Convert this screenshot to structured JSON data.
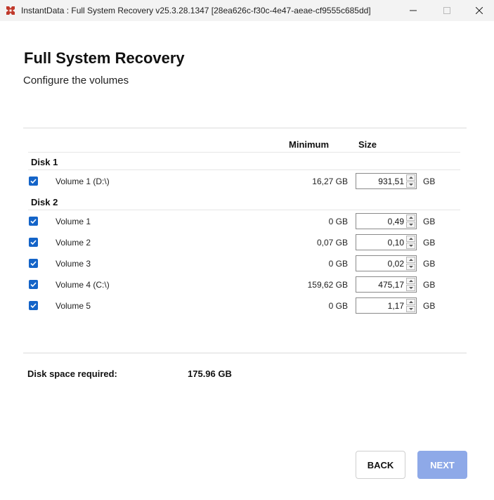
{
  "window": {
    "title": "InstantData : Full System Recovery v25.3.28.1347 [28ea626c-f30c-4e47-aeae-cf9555c685dd]",
    "icon": "app-logo-icon",
    "accent": "#c0392b"
  },
  "header": {
    "title": "Full System Recovery",
    "subtitle": "Configure the volumes"
  },
  "table": {
    "columns": {
      "minimum": "Minimum",
      "size": "Size"
    },
    "disks": [
      {
        "label": "Disk 1",
        "volumes": [
          {
            "name": "Volume 1 (D:\\)",
            "minimum": "16,27 GB",
            "size": "931,51",
            "unit": "GB",
            "checked": true
          }
        ]
      },
      {
        "label": "Disk 2",
        "volumes": [
          {
            "name": "Volume 1",
            "minimum": "0 GB",
            "size": "0,49",
            "unit": "GB",
            "checked": true
          },
          {
            "name": "Volume 2",
            "minimum": "0,07 GB",
            "size": "0,10",
            "unit": "GB",
            "checked": true
          },
          {
            "name": "Volume 3",
            "minimum": "0 GB",
            "size": "0,02",
            "unit": "GB",
            "checked": true
          },
          {
            "name": "Volume 4 (C:\\)",
            "minimum": "159,62 GB",
            "size": "475,17",
            "unit": "GB",
            "checked": true
          },
          {
            "name": "Volume 5",
            "minimum": "0 GB",
            "size": "1,17",
            "unit": "GB",
            "checked": true
          }
        ]
      }
    ]
  },
  "summary": {
    "label": "Disk space required:",
    "value": "175.96 GB"
  },
  "buttons": {
    "back": "BACK",
    "next": "NEXT"
  },
  "colors": {
    "checkbox": "#1464c8",
    "next_button": "#8ea9e8"
  }
}
